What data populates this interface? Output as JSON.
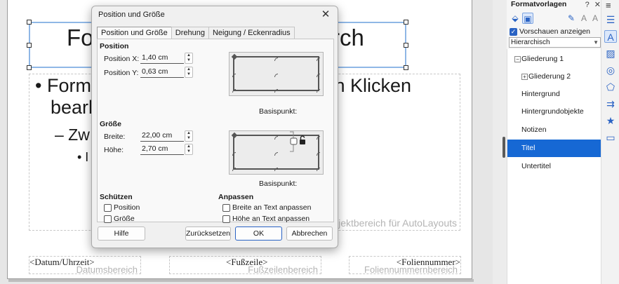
{
  "slide": {
    "title_left": "Fo",
    "title_right": "rch",
    "outline_line1_left": "• Form",
    "outline_line1_right": "rch Klicken",
    "outline_line2": "bearb",
    "outline_level2": "– Zw",
    "outline_level3": "• I",
    "outline_placeholder": "jektbereich für AutoLayouts",
    "footer": {
      "date_field": "<Datum/Uhrzeit>",
      "date_area": "Datumsbereich",
      "footer_field": "<Fußzeile>",
      "footer_area": "Fußzeilenbereich",
      "number_field": "<Foliennummer>",
      "number_area": "Foliennummernbereich"
    }
  },
  "dialog": {
    "title": "Position und Größe",
    "close": "✕",
    "tabs": [
      "Position und Größe",
      "Drehung",
      "Neigung / Eckenradius"
    ],
    "position": {
      "heading": "Position",
      "x_label": "Position X:",
      "x_value": "1,40 cm",
      "y_label": "Position Y:",
      "y_value": "0,63 cm",
      "basis_label": "Basispunkt:"
    },
    "size": {
      "heading": "Größe",
      "width_label": "Breite:",
      "width_value": "22,00 cm",
      "height_label": "Höhe:",
      "height_value": "2,70 cm",
      "basis_label": "Basispunkt:"
    },
    "protect": {
      "heading": "Schützen",
      "position": "Position",
      "size": "Größe"
    },
    "fit": {
      "heading": "Anpassen",
      "width_to_text": "Breite an Text anpassen",
      "height_to_text": "Höhe an Text anpassen"
    },
    "buttons": {
      "help": "Hilfe",
      "reset": "Zurücksetzen",
      "ok": "OK",
      "cancel": "Abbrechen"
    }
  },
  "sidebar": {
    "title": "Formatvorlagen",
    "help": "?",
    "close": "✕",
    "menu": "≡",
    "preview_label": "Vorschauen anzeigen",
    "filter_value": "Hierarchisch",
    "items": [
      "Gliederung 1",
      "Gliederung 2",
      "Hintergrund",
      "Hintergrundobjekte",
      "Notizen",
      "Titel",
      "Untertitel"
    ],
    "selected": "Titel",
    "accent": "#1668d4"
  }
}
